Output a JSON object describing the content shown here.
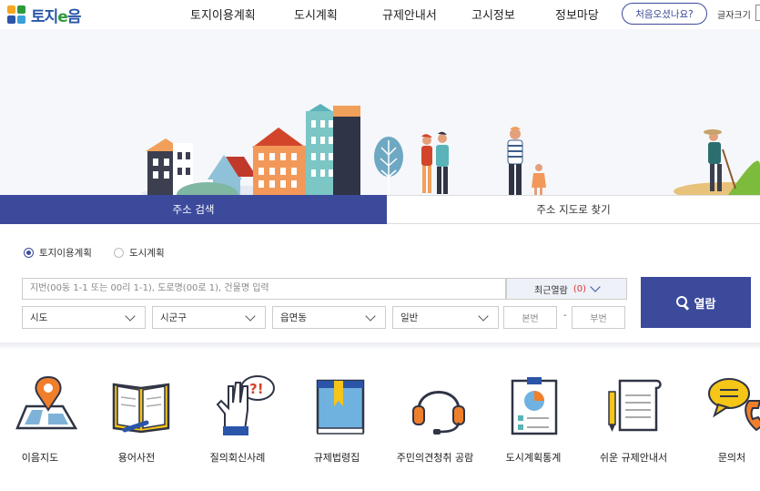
{
  "header": {
    "logo_text_a": "토지",
    "logo_text_b": "e",
    "logo_text_c": "음",
    "nav": [
      "토지이용계획",
      "도시계획",
      "규제안내서",
      "고시정보",
      "정보마당"
    ],
    "first_visit_button": "처음오셨나요?",
    "font_size_label": "글자크기"
  },
  "tabs": {
    "address_search": "주소 검색",
    "map_search": "주소 지도로 찾기"
  },
  "search": {
    "radio_options": [
      "토지이용계획",
      "도시계획"
    ],
    "selected_radio": "토지이용계획",
    "input_placeholder": "지번(00동 1-1 또는 00리 1-1), 도로명(00로 1), 건물명 입력",
    "recent_label": "최근열람",
    "recent_count": "(0)",
    "selects": [
      "시도",
      "시군구",
      "읍면동",
      "일반"
    ],
    "main_number_placeholder": "본번",
    "sub_number_placeholder": "부번",
    "dash": "-",
    "view_button": "열람"
  },
  "quick_menu": [
    {
      "label": "이음지도",
      "icon": "map-pin-icon"
    },
    {
      "label": "용어사전",
      "icon": "book-icon"
    },
    {
      "label": "질의회신사례",
      "icon": "hand-question-icon"
    },
    {
      "label": "규제법령집",
      "icon": "law-book-icon"
    },
    {
      "label": "주민의견청취 공람",
      "icon": "headset-icon"
    },
    {
      "label": "도시계획통계",
      "icon": "chart-board-icon"
    },
    {
      "label": "쉬운 규제안내서",
      "icon": "document-pencil-icon"
    },
    {
      "label": "문의처",
      "icon": "phone-bubble-icon"
    }
  ],
  "colors": {
    "primary": "#3c4a9c",
    "icon_yellow": "#f5c518",
    "icon_orange": "#f07f2b"
  }
}
